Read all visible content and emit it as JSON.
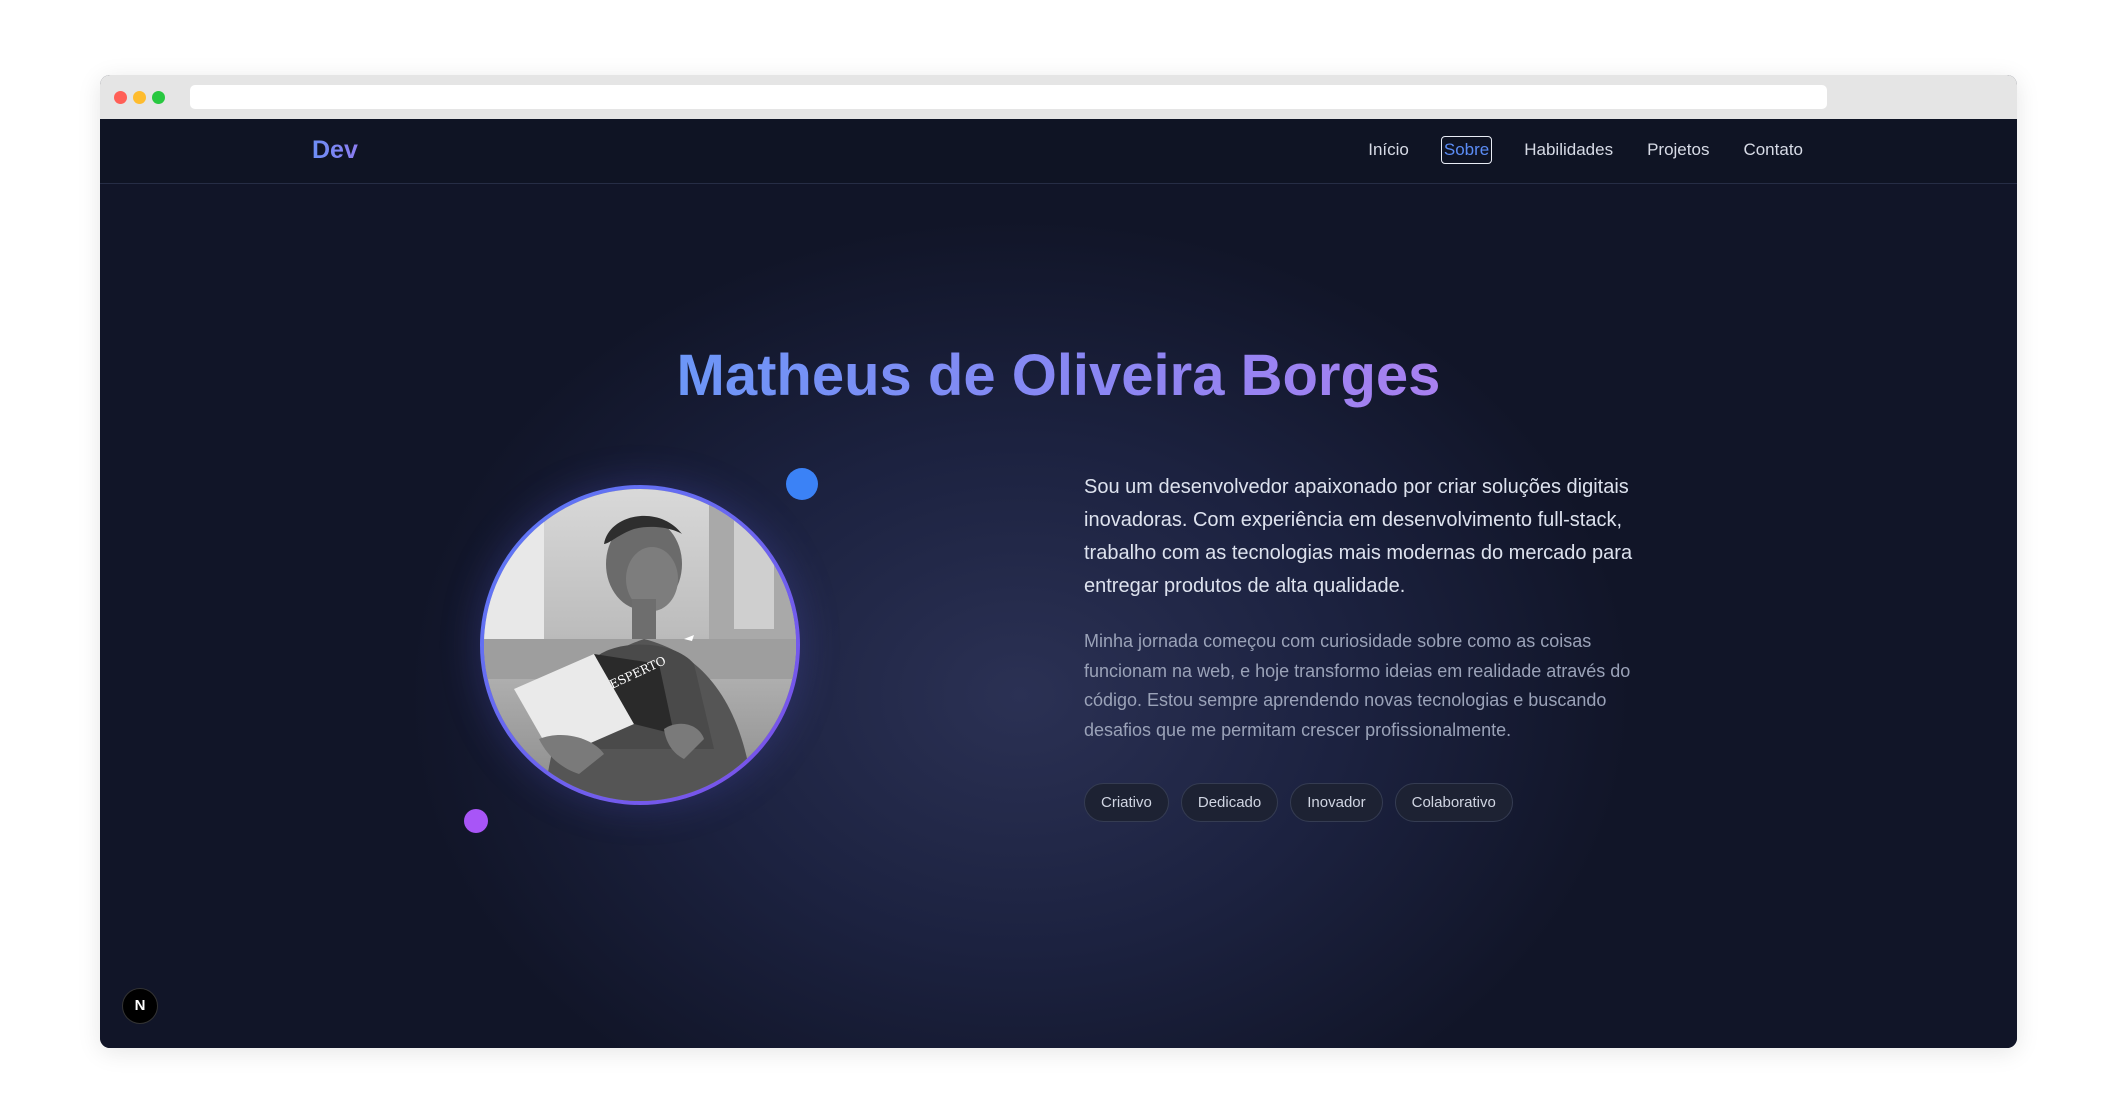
{
  "nav": {
    "brand": "Dev",
    "links": [
      {
        "label": "Início",
        "active": false
      },
      {
        "label": "Sobre",
        "active": true
      },
      {
        "label": "Habilidades",
        "active": false
      },
      {
        "label": "Projetos",
        "active": false
      },
      {
        "label": "Contato",
        "active": false
      }
    ]
  },
  "about": {
    "title": "Matheus de Oliveira Borges",
    "lead": "Sou um desenvolvedor apaixonado por criar soluções digitais inovadoras. Com experiência em desenvolvimento full-stack, trabalho com as tecnologias mais modernas do mercado para entregar produtos de alta qualidade.",
    "detail": "Minha jornada começou com curiosidade sobre como as coisas funcionam na web, e hoje transformo ideias em realidade através do código. Estou sempre aprendendo novas tecnologias e buscando desafios que me permitam crescer profissionalmente.",
    "tags": [
      "Criativo",
      "Dedicado",
      "Inovador",
      "Colaborativo"
    ]
  },
  "badge": {
    "icon": "nextjs-logo-icon"
  },
  "colors": {
    "accent_blue": "#3b82f6",
    "accent_purple": "#a855f7",
    "background": "#0f172a"
  }
}
